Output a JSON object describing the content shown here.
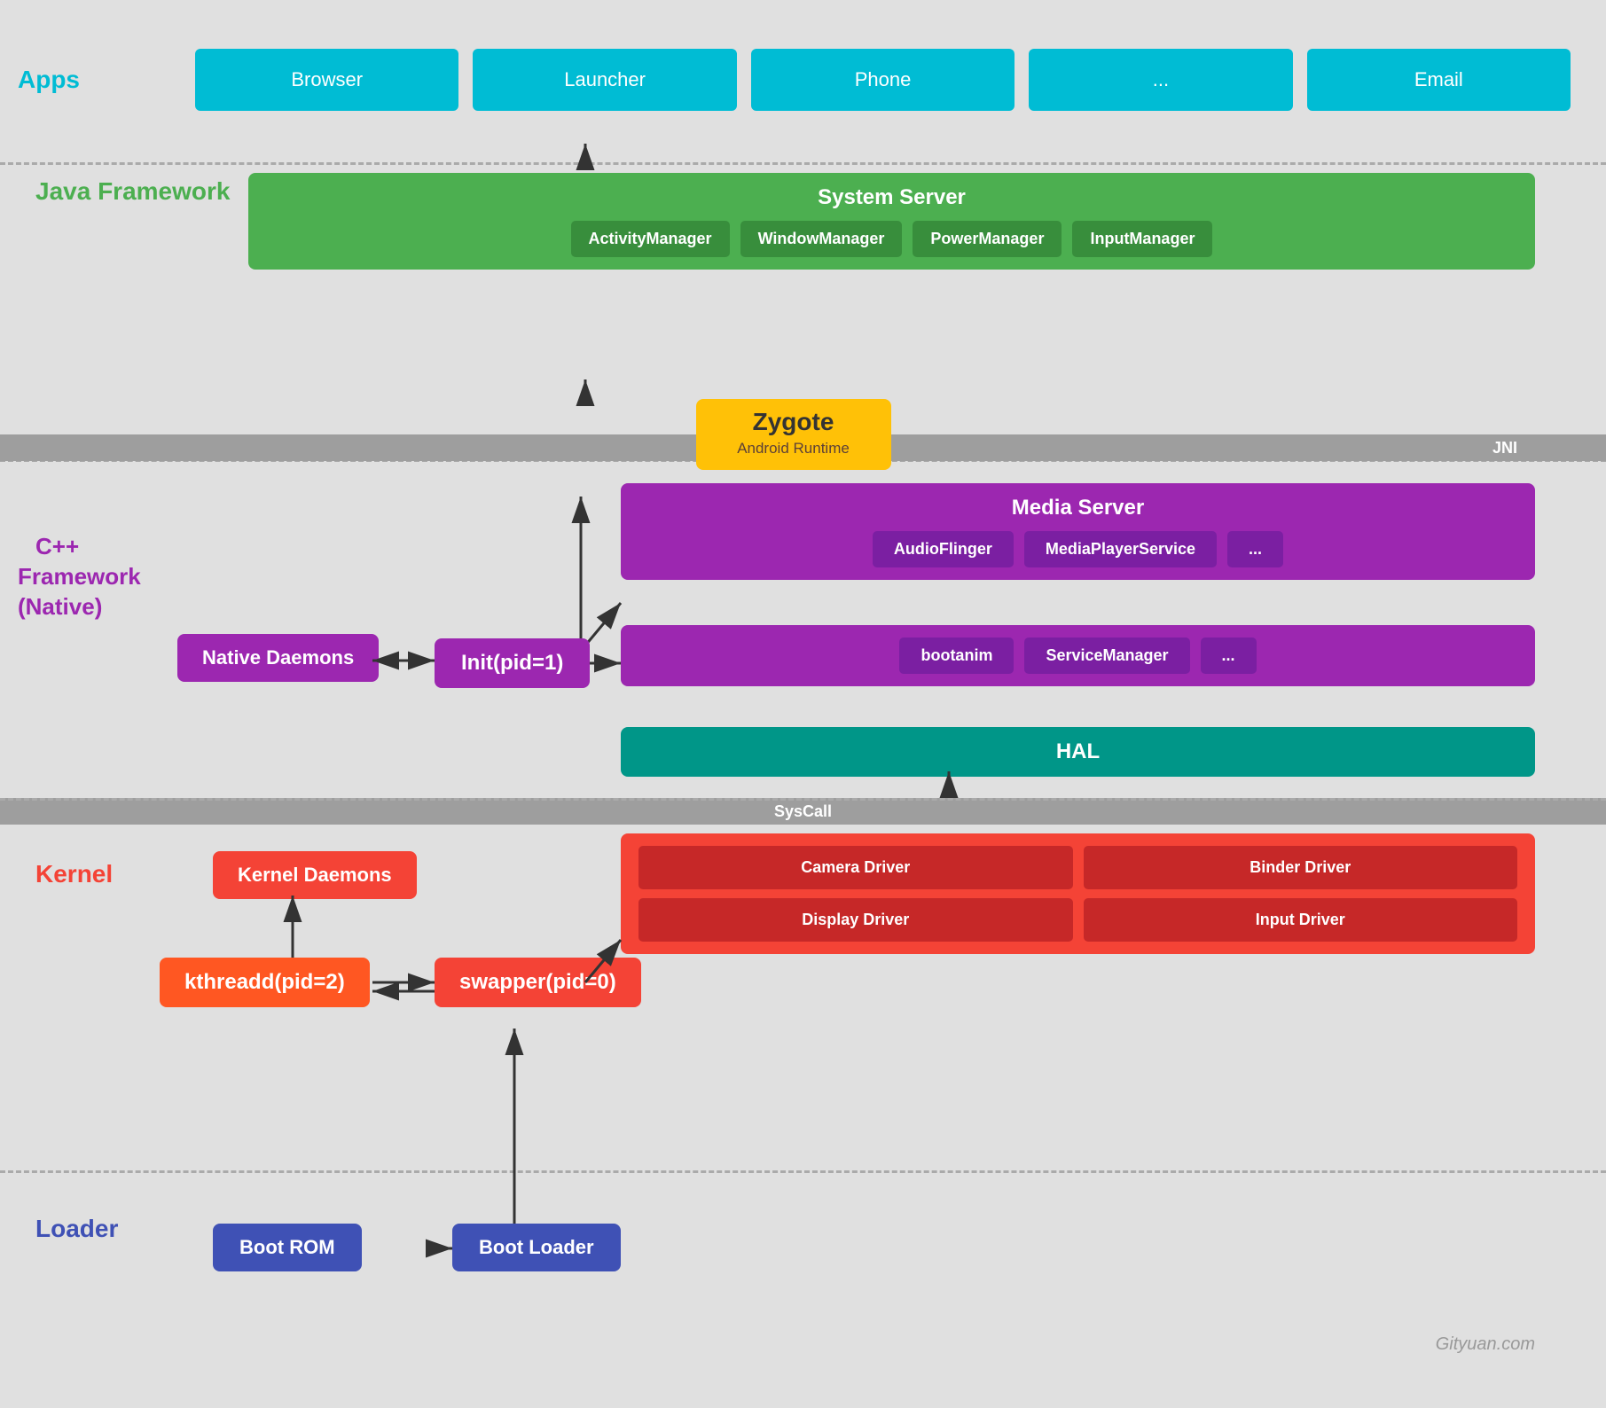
{
  "layers": {
    "apps": {
      "label": "Apps",
      "items": [
        "Browser",
        "Launcher",
        "Phone",
        "...",
        "Email"
      ]
    },
    "java_framework": {
      "label": "Java Framework",
      "system_server": {
        "title": "System Server",
        "items": [
          "ActivityManager",
          "WindowManager",
          "PowerManager",
          "InputManager"
        ]
      }
    },
    "jni": {
      "label": "JNI"
    },
    "zygote": {
      "title": "Zygote",
      "subtitle": "Android Runtime"
    },
    "cpp_framework": {
      "label": "C++ Framework\n(Native)",
      "media_server": {
        "title": "Media Server",
        "items": [
          "AudioFlinger",
          "MediaPlayerService",
          "..."
        ]
      },
      "init": "Init(pid=1)",
      "native_daemons": "Native Daemons",
      "boot_services": [
        "bootanim",
        "ServiceManager",
        "..."
      ],
      "hal": "HAL"
    },
    "syscall": {
      "label": "SysCall"
    },
    "kernel": {
      "label": "Kernel",
      "kernel_daemons": "Kernel Daemons",
      "kthreadd": "kthreadd(pid=2)",
      "swapper": "swapper(pid=0)",
      "drivers": {
        "row1": [
          "Camera Driver",
          "Binder Driver"
        ],
        "row2": [
          "Display Driver",
          "Input Driver"
        ]
      }
    },
    "loader": {
      "label": "Loader",
      "boot_rom": "Boot ROM",
      "boot_loader": "Boot Loader"
    }
  },
  "watermark": "Gityuan.com"
}
